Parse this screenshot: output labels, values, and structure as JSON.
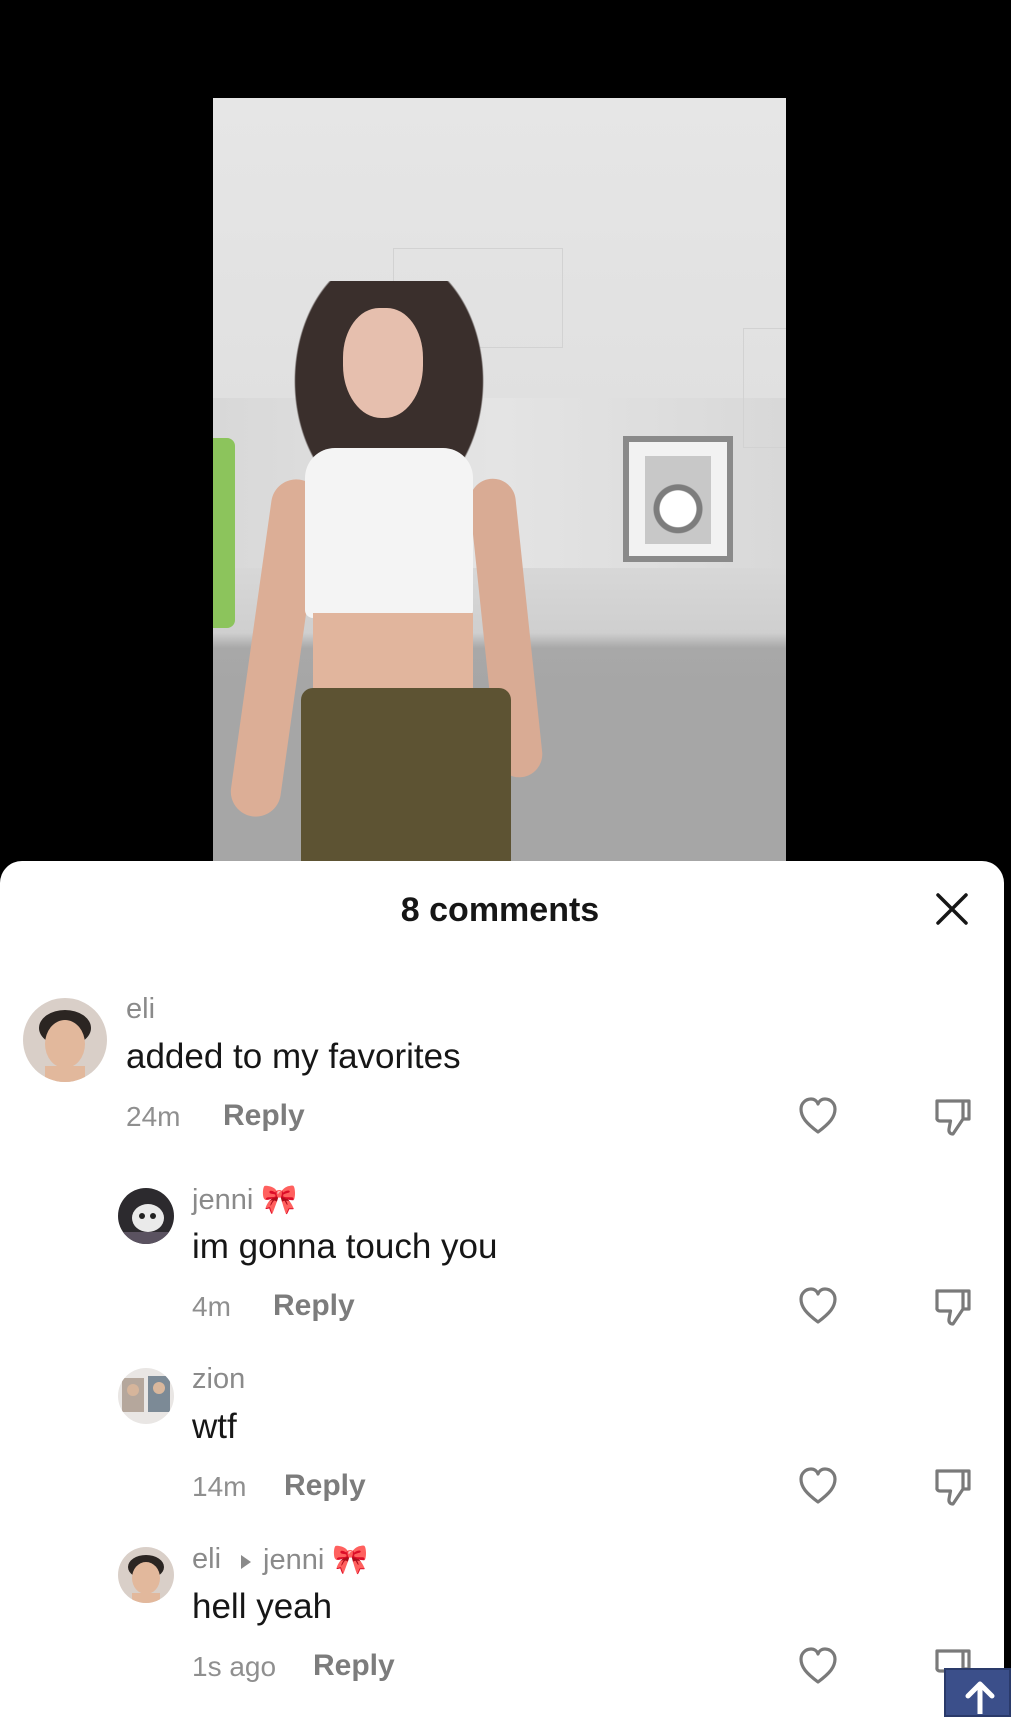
{
  "sheet": {
    "title": "8 comments"
  },
  "comments": [
    {
      "user": "eli",
      "text": "added to my favorites",
      "time": "24m",
      "reply_label": "Reply"
    },
    {
      "user": "jenni 🎀",
      "text": "im gonna touch you",
      "time": "4m",
      "reply_label": "Reply"
    },
    {
      "user": "zion",
      "text": "wtf",
      "time": "14m",
      "reply_label": "Reply"
    },
    {
      "user": "eli",
      "reply_to": "jenni 🎀",
      "text": "hell yeah",
      "time": "1s ago",
      "reply_label": "Reply"
    }
  ],
  "icons": {
    "close": "close-icon",
    "like": "heart-icon",
    "dislike": "thumbs-down-icon",
    "reply_arrow": "caret-right-icon",
    "scroll": "arrow-up-icon"
  },
  "colors": {
    "sheet_bg": "#ffffff",
    "text_primary": "#161616",
    "text_secondary": "#8a8a8a",
    "scroll_button": "#3b4f8a"
  }
}
